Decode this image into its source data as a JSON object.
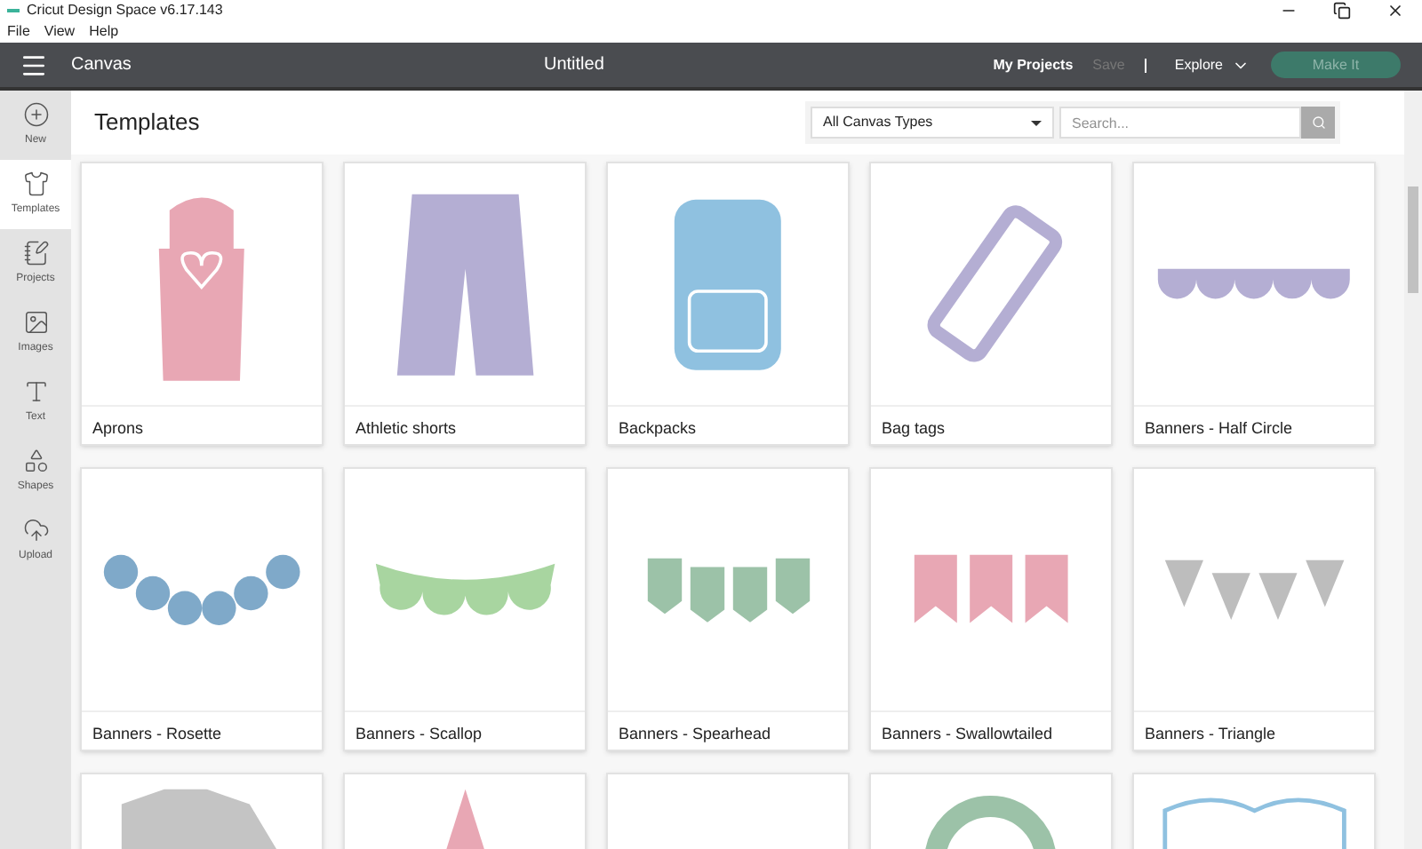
{
  "window": {
    "title": "Cricut Design Space  v6.17.143"
  },
  "menu": [
    "File",
    "View",
    "Help"
  ],
  "header": {
    "section": "Canvas",
    "document": "Untitled",
    "my_projects": "My Projects",
    "save": "Save",
    "save_disabled": true,
    "explore": "Explore",
    "make_it": "Make It"
  },
  "sidebar": [
    {
      "label": "New",
      "kind": "new",
      "selected": false
    },
    {
      "label": "Templates",
      "kind": "templates",
      "selected": true
    },
    {
      "label": "Projects",
      "kind": "projects",
      "selected": false
    },
    {
      "label": "Images",
      "kind": "images",
      "selected": false
    },
    {
      "label": "Text",
      "kind": "text",
      "selected": false
    },
    {
      "label": "Shapes",
      "kind": "shapes",
      "selected": false
    },
    {
      "label": "Upload",
      "kind": "upload",
      "selected": false
    }
  ],
  "page_title": "Templates",
  "filter": {
    "value": "All Canvas Types"
  },
  "search": {
    "placeholder": "Search..."
  },
  "templates": [
    {
      "name": "Aprons",
      "kind": "apron"
    },
    {
      "name": "Athletic shorts",
      "kind": "shorts"
    },
    {
      "name": "Backpacks",
      "kind": "backpack"
    },
    {
      "name": "Bag tags",
      "kind": "bagtag"
    },
    {
      "name": "Banners - Half Circle",
      "kind": "halfcircle"
    },
    {
      "name": "Banners - Rosette",
      "kind": "rosette"
    },
    {
      "name": "Banners - Scallop",
      "kind": "scallop"
    },
    {
      "name": "Banners - Spearhead",
      "kind": "spearhead"
    },
    {
      "name": "Banners - Swallowtailed",
      "kind": "swallow"
    },
    {
      "name": "Banners - Triangle",
      "kind": "triangle"
    },
    {
      "kind": "shirt"
    },
    {
      "kind": "cone"
    },
    {
      "kind": "blank"
    },
    {
      "kind": "ring"
    },
    {
      "kind": "book"
    }
  ]
}
